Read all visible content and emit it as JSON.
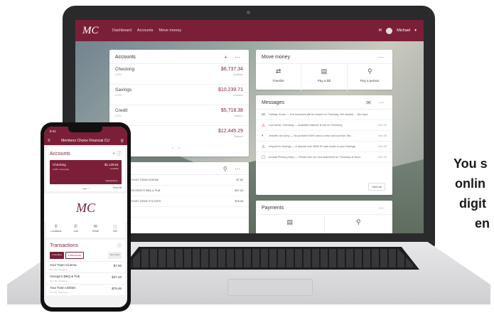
{
  "laptop": {
    "logo": "MC",
    "nav": [
      "Dashboard",
      "Accounts",
      "Move money"
    ],
    "user": "Michael",
    "accounts": {
      "title": "Accounts",
      "tools": "+ ⋯",
      "rows": [
        {
          "name": "Checking",
          "sub": "•1234",
          "balance": "$6,737.34",
          "caption": "Available"
        },
        {
          "name": "Savings",
          "sub": "•1234",
          "balance": "$10,239.71",
          "caption": "Available"
        },
        {
          "name": "Credit",
          "sub": "•1234",
          "balance": "$5,718.38",
          "caption": "Balance"
        },
        {
          "name": "",
          "sub": "",
          "balance": "$12,445.29",
          "caption": "Balance"
        }
      ],
      "dots": "• •"
    },
    "move_money": {
      "title": "Move money",
      "tools": "⋯",
      "items": [
        {
          "label": "Transfer",
          "icon": "⇄"
        },
        {
          "label": "Pay a bill",
          "icon": "▤"
        },
        {
          "label": "Pay a person",
          "icon": "⚲"
        }
      ]
    },
    "messages": {
      "title": "Messages",
      "tools": "✉ ⋯",
      "rows": [
        {
          "icon": "✉",
          "warn": false,
          "text": "Holiday Hours — Our branches will be closed on Thursday. We wanted ... We hope",
          "date": ""
        },
        {
          "icon": "⚠",
          "warn": true,
          "text": "Low funds: Checking — Available balance is low on Checking",
          "date": "Nov 25"
        },
        {
          "icon": "◐",
          "warn": false,
          "text": "Jennifer and Amy — No problem! We'll send a new card out that. We...",
          "date": "Nov 25"
        },
        {
          "icon": "⚠",
          "warn": true,
          "text": "Deposit to Savings — A deposit over $500.00 was made to your Savings",
          "date": "Nov 25"
        },
        {
          "icon": "☐",
          "warn": false,
          "text": "Annual Privacy policy — Please see our new statement on Thursday at Noon",
          "date": "Nov 18"
        }
      ],
      "view_all": "View all"
    },
    "transactions": {
      "tools": "⚲ ⋯",
      "rows": [
        {
          "name": "YOUR TOWN CINEMA",
          "amount": "$7.50"
        },
        {
          "name": "GEORGE'S BBQ & PUB",
          "amount": "$37.25"
        },
        {
          "name": "YOUR TOWN UTILITIES",
          "amount": "$78.46"
        },
        {
          "name": "",
          "amount": ""
        }
      ]
    },
    "payments": {
      "title": "Payments",
      "tools": "⋯",
      "icons": [
        "▤",
        "⚲"
      ]
    }
  },
  "phone": {
    "time": "9:41",
    "header_title": "Members Choice Financial CU",
    "accounts_title": "Accounts",
    "accounts_tools": "+ ⓘ",
    "account": {
      "name": "Checking",
      "sub": "•1234 • Everyday",
      "balance": "$1,139.81",
      "caption": "Available",
      "transactions_link": "Transactions ›"
    },
    "dots": "• ▬ • •",
    "view_all": "View all",
    "logo": "MC",
    "quick_links": [
      {
        "label": "Locations",
        "icon": "⚲"
      },
      {
        "label": "Call",
        "icon": "✆"
      },
      {
        "label": "Email",
        "icon": "✉"
      },
      {
        "label": "Info",
        "icon": "ⓘ"
      }
    ],
    "transactions_title": "Transactions",
    "transactions_help": "ⓘ",
    "filters": [
      "1 Pending",
      "2 Withdrawals",
      "Dec 2014"
    ],
    "transactions": [
      {
        "name": "Your Town Cinema",
        "date": "Nov 4th, Checking",
        "amount": "$7.50"
      },
      {
        "name": "George's BBQ & Pub",
        "date": "Nov 4th, Checking",
        "amount": "$37.25"
      },
      {
        "name": "Your Town Utilities",
        "date": "Nov 4th, Checking",
        "amount": "$78.46"
      }
    ]
  },
  "tagline": [
    "You s",
    "onlin",
    "digit",
    "en"
  ],
  "colors": {
    "brand": "#7b1f38"
  }
}
